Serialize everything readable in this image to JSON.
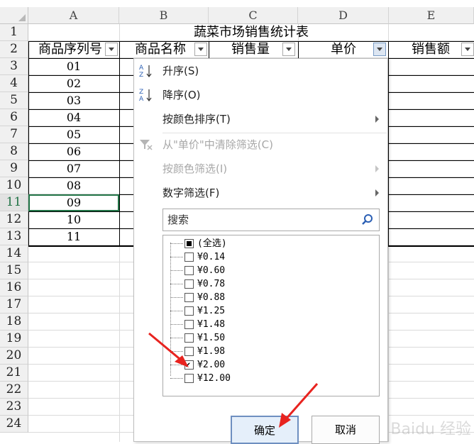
{
  "columns": [
    "A",
    "B",
    "C",
    "D",
    "E"
  ],
  "rows": [
    "1",
    "2",
    "3",
    "4",
    "5",
    "6",
    "7",
    "8",
    "9",
    "10",
    "11",
    "12",
    "13",
    "14",
    "15",
    "16",
    "17",
    "18",
    "19",
    "20",
    "21",
    "22",
    "23",
    "24"
  ],
  "table": {
    "title": "蔬菜市场销售统计表",
    "headers": [
      "商品序列号",
      "商品名称",
      "销售量",
      "单价",
      "销售额"
    ],
    "seq": [
      "01",
      "02",
      "03",
      "04",
      "05",
      "06",
      "07",
      "08",
      "09",
      "10",
      "11"
    ]
  },
  "menu": {
    "sort_asc": "升序(S)",
    "sort_desc": "降序(O)",
    "sort_by_color": "按颜色排序(T)",
    "clear_filter": "从\"单价\"中清除筛选(C)",
    "filter_by_color": "按颜色筛选(I)",
    "number_filter": "数字筛选(F)",
    "search_placeholder": "搜索",
    "select_all": "(全选)",
    "values": [
      {
        "label": "¥0.14",
        "checked": false
      },
      {
        "label": "¥0.60",
        "checked": false
      },
      {
        "label": "¥0.78",
        "checked": false
      },
      {
        "label": "¥0.88",
        "checked": false
      },
      {
        "label": "¥1.25",
        "checked": false
      },
      {
        "label": "¥1.48",
        "checked": false
      },
      {
        "label": "¥1.50",
        "checked": false
      },
      {
        "label": "¥1.98",
        "checked": false
      },
      {
        "label": "¥2.00",
        "checked": true
      },
      {
        "label": "¥12.00",
        "checked": false
      }
    ],
    "ok": "确定",
    "cancel": "取消"
  },
  "watermark": "Baidu 经验",
  "colors": {
    "accent": "#217346",
    "arrow": "#e8231f"
  }
}
